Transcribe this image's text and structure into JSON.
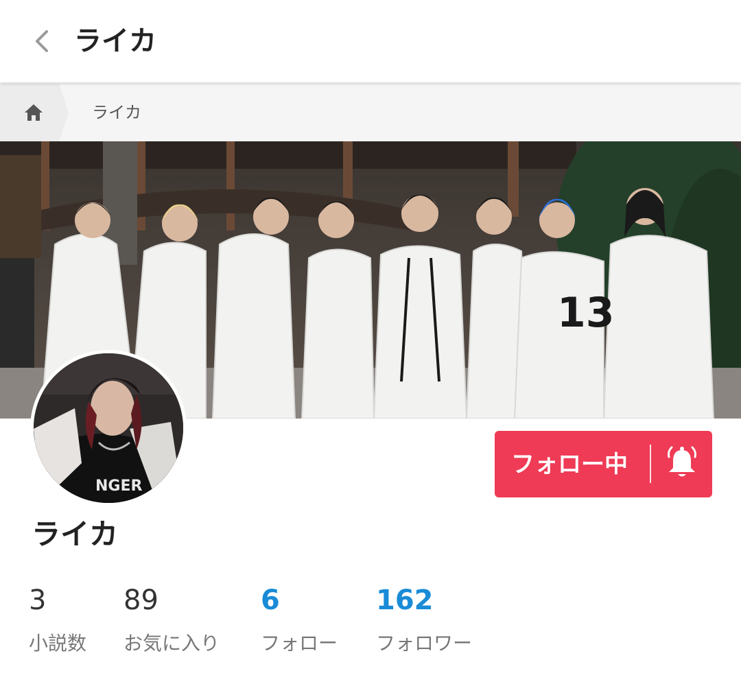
{
  "header": {
    "title": "ライカ",
    "back_icon": "chevron-left-icon"
  },
  "breadcrumb": {
    "home_icon": "home-icon",
    "current": "ライカ"
  },
  "profile": {
    "name": "ライカ",
    "follow_button": {
      "label": "フォロー中",
      "icon": "bell-icon",
      "color": "#ef3b55"
    }
  },
  "stats": [
    {
      "value": "3",
      "label": "小説数",
      "link": false
    },
    {
      "value": "89",
      "label": "お気に入り",
      "link": false
    },
    {
      "value": "6",
      "label": "フォロー",
      "link": true
    },
    {
      "value": "162",
      "label": "フォロワー",
      "link": true
    }
  ],
  "colors": {
    "accent": "#ef3b55",
    "link": "#1a8bd6"
  }
}
